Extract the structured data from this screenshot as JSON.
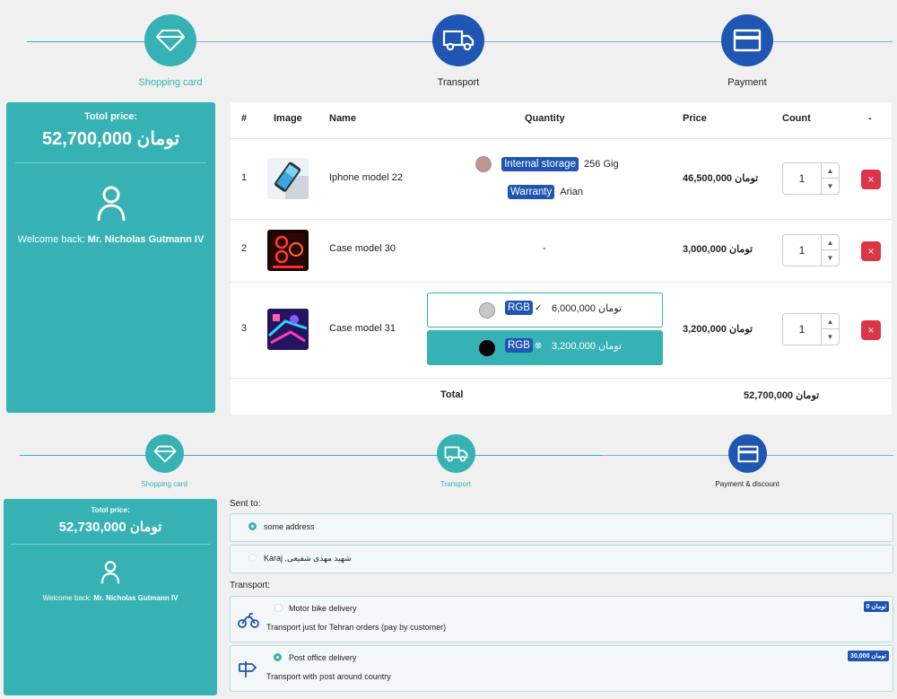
{
  "top": {
    "steps": [
      {
        "label": "Shopping card",
        "icon": "diamond-icon",
        "state": "done"
      },
      {
        "label": "Transport",
        "icon": "truck-icon",
        "state": "active"
      },
      {
        "label": "Payment",
        "icon": "credit-card-icon",
        "state": "active"
      }
    ],
    "sidebar": {
      "total_label": "Totol price:",
      "total_value": "52,700,000 تومان",
      "welcome_prefix": "Welcome back:",
      "user_name": "Mr. Nicholas Gutmann IV"
    },
    "table": {
      "headers": [
        "#",
        "Image",
        "Name",
        "Quantity",
        "Price",
        "Count",
        "-"
      ],
      "rows": [
        {
          "num": "1",
          "name": "Iphone model 22",
          "price": "46,500,000 تومان",
          "count": "1",
          "attrs": [
            {
              "badge": "Internal storage",
              "value": "256 Gig"
            },
            {
              "badge": "Warranty",
              "value": "Arian"
            }
          ]
        },
        {
          "num": "2",
          "name": "Case model 30",
          "price": "3,000,000 تومان",
          "count": "1",
          "quantity_text": "-"
        },
        {
          "num": "3",
          "name": "Case model 31",
          "price": "3,200,000 تومان",
          "count": "1",
          "options": [
            {
              "badge": "RGB",
              "price": "6,000,000 تومان",
              "selected": false
            },
            {
              "badge": "RGB",
              "price": "3,200,000 تومان",
              "selected": true
            }
          ]
        }
      ],
      "total_label": "Total",
      "total_value": "52,700,000 تومان",
      "delete_symbol": "×"
    }
  },
  "bottom": {
    "steps": [
      {
        "label": "Shopping card",
        "icon": "diamond-icon",
        "state": "done"
      },
      {
        "label": "Transport",
        "icon": "truck-icon",
        "state": "done"
      },
      {
        "label": "Payment & discount",
        "icon": "credit-card-icon",
        "state": "active"
      }
    ],
    "sidebar": {
      "total_label": "Totol price:",
      "total_value": "52,730,000 تومان",
      "welcome_prefix": "Welcome back:",
      "user_name": "Mr. Nicholas Gutmann IV"
    },
    "sent_to_label": "Sent to:",
    "addresses": [
      {
        "text": "some address",
        "selected": true
      },
      {
        "text": "Karaj ,شهید مهدی شفیعی",
        "selected": false
      }
    ],
    "transport_label": "Transport:",
    "transports": [
      {
        "title": "Motor bike delivery",
        "desc": "Transport just for Tehran orders (pay by customer)",
        "price": "0 تومان",
        "icon": "motorbike-icon",
        "selected": false
      },
      {
        "title": "Post office delivery",
        "desc": "Transport with post around country",
        "price": "30,000 تومان",
        "icon": "signpost-icon",
        "selected": true
      }
    ]
  },
  "colors": {
    "teal": "#36b2b5",
    "blue": "#1f55b3",
    "red": "#dc3545"
  }
}
